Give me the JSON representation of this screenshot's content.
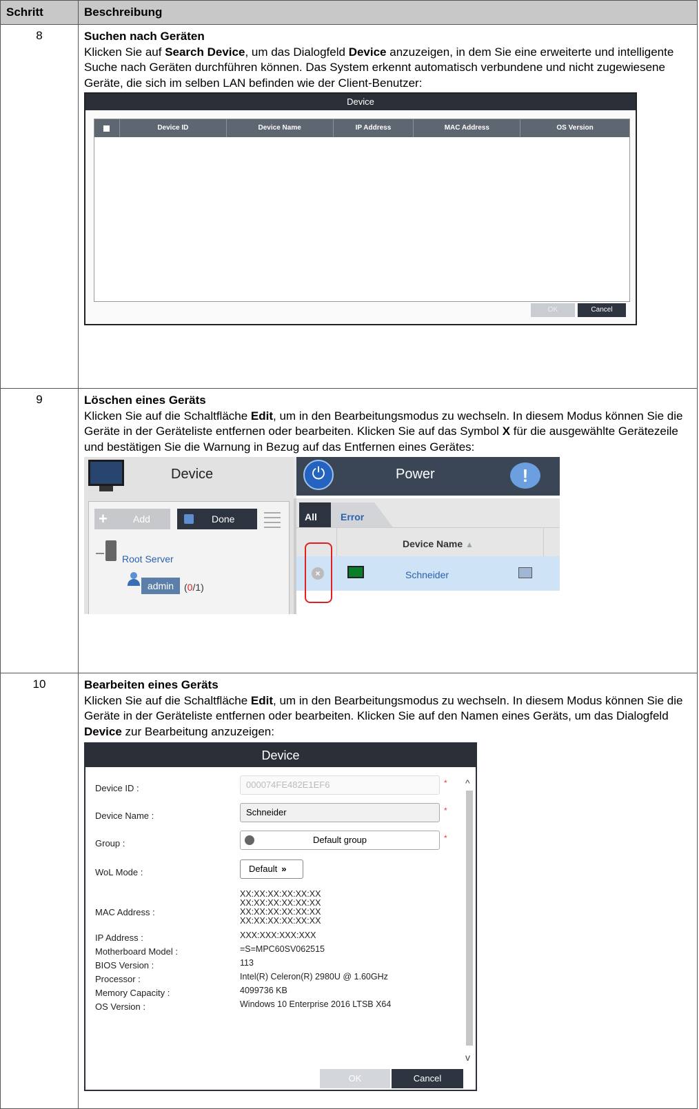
{
  "header": {
    "col_step": "Schritt",
    "col_desc": "Beschreibung"
  },
  "step8": {
    "num": "8",
    "title": "Suchen nach Geräten",
    "text_a": "Klicken Sie auf ",
    "bold_a": "Search Device",
    "text_b": ", um das Dialogfeld ",
    "bold_b": "Device",
    "text_c": " anzuzeigen, in dem Sie eine erweiterte und intelligente Suche nach Geräten durchführen können. Das System erkennt automatisch verbundene und nicht zugewiesene Geräte, die sich im selben LAN befinden wie der Client-Benutzer:",
    "dialog": {
      "title": "Device",
      "columns": [
        "Device ID",
        "Device Name",
        "IP Address",
        "MAC Address",
        "OS Version"
      ],
      "ok": "OK",
      "cancel": "Cancel"
    }
  },
  "step9": {
    "num": "9",
    "title": "Löschen eines Geräts",
    "text_a": "Klicken Sie auf die Schaltfläche ",
    "bold_a": "Edit",
    "text_b": ", um in den Bearbeitungsmodus zu wechseln. In diesem Modus können Sie die Geräte in der Geräteliste entfernen oder bearbeiten. Klicken Sie auf das Symbol ",
    "bold_b": "X",
    "text_c": " für die ausgewählte Gerätezeile und bestätigen Sie die Warnung in Bezug auf das Entfernen eines Gerätes:",
    "panel": {
      "device_title": "Device",
      "power_title": "Power",
      "add": "Add",
      "done": "Done",
      "root_server": "Root Server",
      "admin": "admin",
      "count_open": "(",
      "count_red": "0",
      "count_rest": "/1)",
      "tab_all": "All",
      "tab_error": "Error",
      "col_device_name": "Device Name",
      "row_name": "Schneider"
    }
  },
  "step10": {
    "num": "10",
    "title": "Bearbeiten eines Geräts",
    "text_a": "Klicken Sie auf die Schaltfläche ",
    "bold_a": "Edit",
    "text_b": ", um in den Bearbeitungsmodus zu wechseln. In diesem Modus können Sie die Geräte in der Geräteliste entfernen oder bearbeiten. Klicken Sie auf den Namen eines Geräts, um das Dialogfeld ",
    "bold_b": "Device",
    "text_c": " zur Bearbeitung anzuzeigen:",
    "dialog": {
      "title": "Device",
      "device_id_label": "Device ID :",
      "device_id_value": "000074FE482E1EF6",
      "device_name_label": "Device Name :",
      "device_name_value": "Schneider",
      "group_label": "Group :",
      "group_value": "Default group",
      "wol_label": "WoL Mode :",
      "wol_value": "Default",
      "mac_label": "MAC Address :",
      "mac_values": [
        "XX:XX:XX:XX:XX:XX",
        "XX:XX:XX:XX:XX:XX",
        "XX:XX:XX:XX:XX:XX",
        "XX:XX:XX:XX:XX:XX"
      ],
      "ip_label": "IP Address :",
      "ip_value": "XXX:XXX:XXX:XXX",
      "mb_label": "Motherboard Model :",
      "mb_value": "=S=MPC60SV062515",
      "bios_label": "BIOS Version :",
      "bios_value": "113",
      "cpu_label": "Processor :",
      "cpu_value": "Intel(R) Celeron(R) 2980U @ 1.60GHz",
      "mem_label": "Memory Capacity :",
      "mem_value": "4099736 KB",
      "os_label": "OS Version :",
      "os_value": "Windows 10 Enterprise 2016 LTSB X64",
      "ok": "OK",
      "cancel": "Cancel",
      "required_mark": "*"
    }
  }
}
